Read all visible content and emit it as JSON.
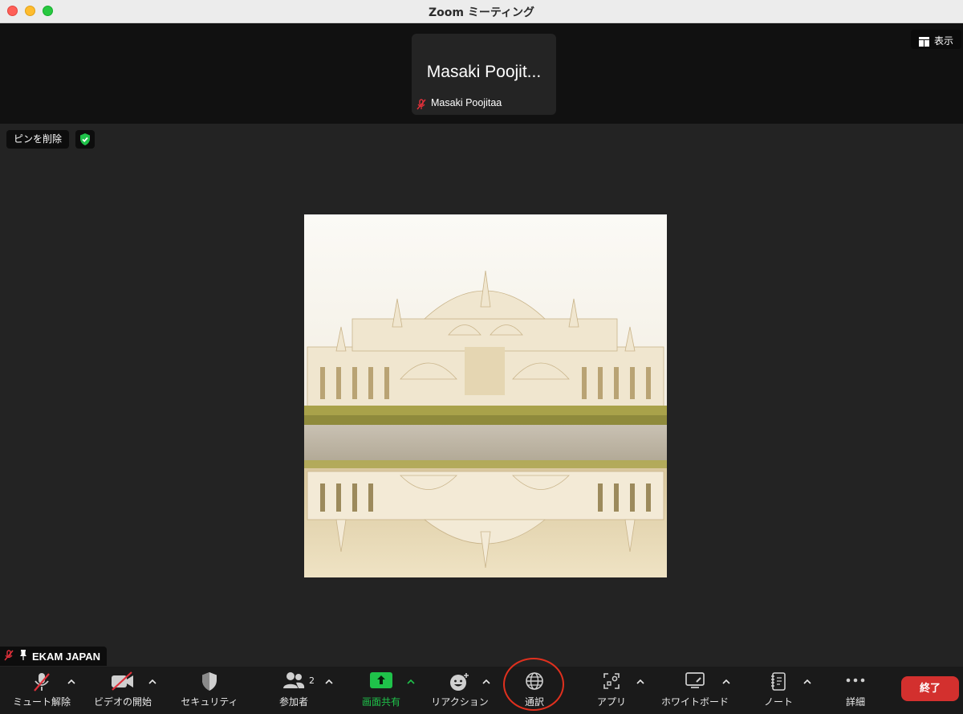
{
  "window": {
    "title": "Zoom ミーティング"
  },
  "top_strip": {
    "participant_tile": {
      "display_name": "Masaki Poojit...",
      "full_name": "Masaki Poojitaa",
      "muted": true
    },
    "view_button": {
      "label": "表示",
      "icon": "grid-view-icon"
    }
  },
  "stage": {
    "unpin_label": "ピンを削除",
    "security_badge_icon": "shield-check-icon",
    "shared_image": {
      "subject": "white palace with reflection"
    },
    "name_tag": {
      "name": "EKAM JAPAN",
      "muted": true,
      "pinned": true
    }
  },
  "toolbar": {
    "unmute": {
      "label": "ミュート解除",
      "icon": "microphone-muted-icon"
    },
    "start_video": {
      "label": "ビデオの開始",
      "icon": "video-off-icon"
    },
    "security": {
      "label": "セキュリティ",
      "icon": "shield-icon"
    },
    "participants": {
      "label": "参加者",
      "count": "2",
      "icon": "participants-icon"
    },
    "share_screen": {
      "label": "画面共有",
      "icon": "share-screen-icon"
    },
    "reactions": {
      "label": "リアクション",
      "icon": "emoji-plus-icon"
    },
    "interpretation": {
      "label": "通訳",
      "icon": "globe-icon"
    },
    "apps": {
      "label": "アプリ",
      "icon": "apps-icon"
    },
    "whiteboard": {
      "label": "ホワイトボード",
      "icon": "whiteboard-icon"
    },
    "notes": {
      "label": "ノート",
      "icon": "notes-icon"
    },
    "more": {
      "label": "詳細",
      "icon": "more-dots-icon"
    },
    "end": {
      "label": "終了"
    }
  },
  "colors": {
    "accent_green": "#1fc24a",
    "end_red": "#d3302e",
    "highlight_circle": "#e0301e",
    "muted_red": "#e0303a"
  }
}
